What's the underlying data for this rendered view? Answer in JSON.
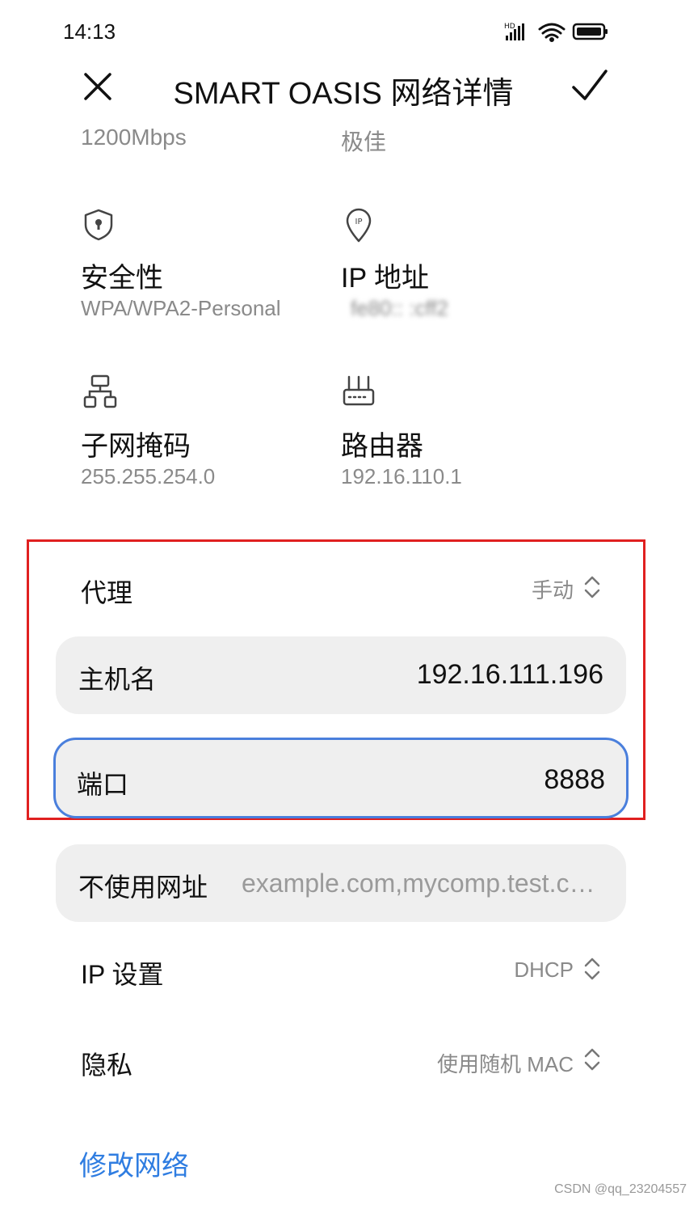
{
  "status_bar": {
    "time": "14:13"
  },
  "header": {
    "title": "SMART OASIS 网络详情"
  },
  "clipped_row": {
    "left": "1200Mbps",
    "right": "极佳"
  },
  "info": {
    "security": {
      "label": "安全性",
      "value": "WPA/WPA2-Personal"
    },
    "ip": {
      "label": "IP 地址",
      "value": "fe80::     :cff2"
    },
    "subnet": {
      "label": "子网掩码",
      "value": "255.255.254.0"
    },
    "router": {
      "label": "路由器",
      "value": "192.16.110.1"
    }
  },
  "proxy": {
    "label": "代理",
    "value": "手动"
  },
  "hostname": {
    "label": "主机名",
    "value": "192.16.111.196"
  },
  "port": {
    "label": "端口",
    "value": "8888"
  },
  "bypass": {
    "label": "不使用网址",
    "placeholder": "example.com,mycomp.test.com,loca"
  },
  "ip_settings": {
    "label": "IP 设置",
    "value": "DHCP"
  },
  "privacy": {
    "label": "隐私",
    "value": "使用随机 MAC"
  },
  "modify_network": "修改网络",
  "watermark": "CSDN @qq_23204557",
  "colors": {
    "accent": "#2f7de1",
    "focus_border": "#4a7fdc",
    "highlight_border": "#e02020",
    "field_bg": "#efefef"
  }
}
